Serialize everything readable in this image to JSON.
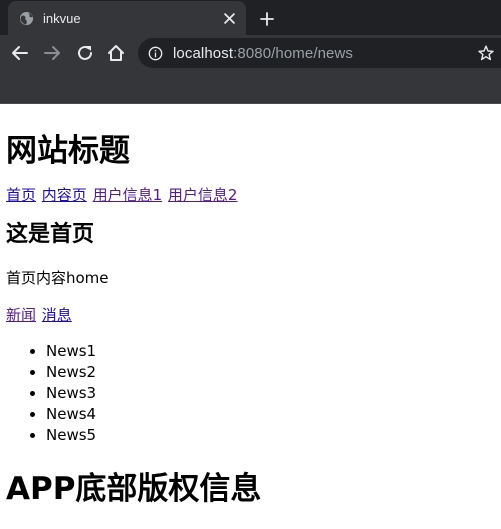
{
  "browser": {
    "tab": {
      "title": "inkvue"
    },
    "address": {
      "host": "localhost",
      "rest": ":8080/home/news"
    },
    "colors": {
      "chrome_dark": "#202124",
      "chrome_toolbar": "#35363a",
      "text_light": "#e8eaed",
      "text_muted": "#9aa0a6"
    }
  },
  "page": {
    "site_title": "网站标题",
    "nav": [
      {
        "label": "首页"
      },
      {
        "label": "内容页"
      },
      {
        "label": "用户信息1"
      },
      {
        "label": "用户信息2"
      }
    ],
    "section_title": "这是首页",
    "section_text": "首页内容home",
    "sub_nav": [
      {
        "label": "新闻"
      },
      {
        "label": "消息"
      }
    ],
    "news": [
      "News1",
      "News2",
      "News3",
      "News4",
      "News5"
    ],
    "footer_title": "APP底部版权信息"
  },
  "icons": {
    "tab_favicon": "globe-icon",
    "tab_close": "close-icon",
    "new_tab": "plus-icon",
    "back": "arrow-left-icon",
    "forward": "arrow-right-icon",
    "reload": "reload-icon",
    "home": "home-icon",
    "site_info": "info-icon",
    "bookmark": "star-icon"
  }
}
